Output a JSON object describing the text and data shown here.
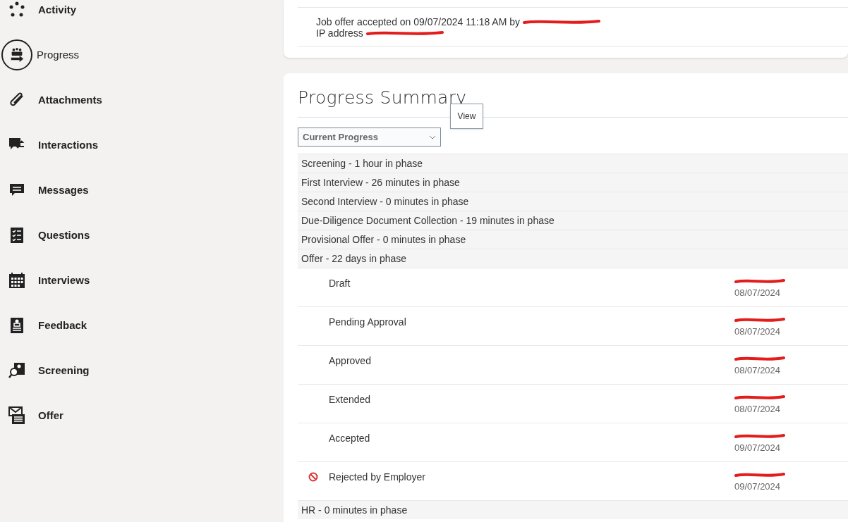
{
  "sidebar": {
    "items": [
      {
        "label": "Activity",
        "selected": false
      },
      {
        "label": "Progress",
        "selected": true
      },
      {
        "label": "Attachments",
        "selected": false
      },
      {
        "label": "Interactions",
        "selected": false
      },
      {
        "label": "Messages",
        "selected": false
      },
      {
        "label": "Questions",
        "selected": false
      },
      {
        "label": "Interviews",
        "selected": false
      },
      {
        "label": "Feedback",
        "selected": false
      },
      {
        "label": "Screening",
        "selected": false
      },
      {
        "label": "Offer",
        "selected": false
      }
    ]
  },
  "activity_card": {
    "lines": [
      {
        "text": "Job offer accepted on 09/07/2024 11:18 AM by",
        "redacted": true
      },
      {
        "text": "IP address",
        "redacted": true
      }
    ]
  },
  "progress_summary": {
    "title": "Progress Summary",
    "view_select": {
      "value": "Current Progress"
    },
    "tooltip": "View",
    "phases": [
      {
        "label": "Screening - 1 hour in phase"
      },
      {
        "label": "First Interview - 26 minutes in phase"
      },
      {
        "label": "Second Interview - 0 minutes in phase"
      },
      {
        "label": "Due-Diligence Document Collection - 19 minutes in phase"
      },
      {
        "label": "Provisional Offer - 0 minutes in phase"
      },
      {
        "label": "Offer - 22 days in phase",
        "children": [
          {
            "status": "Draft",
            "kind": "normal",
            "redacted": true,
            "date": "08/07/2024"
          },
          {
            "status": "Pending Approval",
            "kind": "normal",
            "redacted": true,
            "date": "08/07/2024"
          },
          {
            "status": "Approved",
            "kind": "normal",
            "redacted": true,
            "date": "08/07/2024"
          },
          {
            "status": "Extended",
            "kind": "normal",
            "redacted": true,
            "date": "08/07/2024"
          },
          {
            "status": "Accepted",
            "kind": "normal",
            "redacted": true,
            "date": "09/07/2024"
          },
          {
            "status": "Rejected by Employer",
            "kind": "rejected",
            "redacted": true,
            "date": "09/07/2024"
          }
        ]
      },
      {
        "label": "HR - 0 minutes in phase"
      }
    ]
  }
}
